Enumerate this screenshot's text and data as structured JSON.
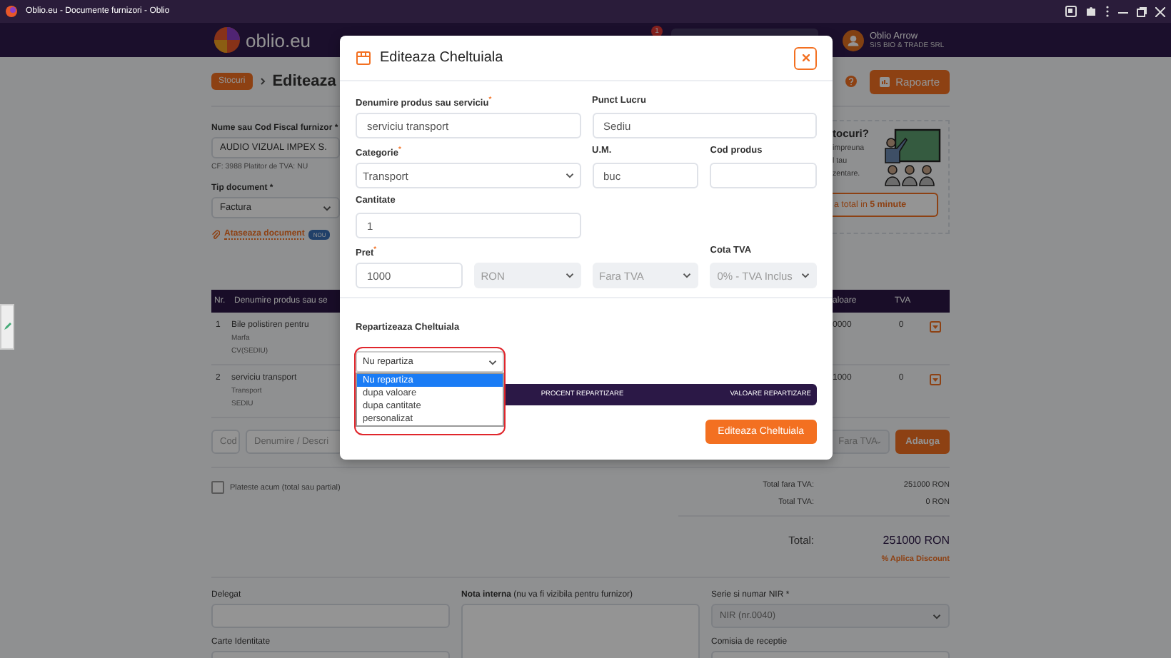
{
  "browser_tab": {
    "title": "Oblio.eu - Documente furnizori - Oblio"
  },
  "header": {
    "logo": "oblio.eu",
    "notification_count": "1",
    "user_name": "Oblio Arrow",
    "company": "SIS BIO & TRADE SRL"
  },
  "breadcrumb": [
    {
      "label": "Stocuri",
      "kind": "badge"
    },
    {
      "label": "Editeaza",
      "kind": "title"
    }
  ],
  "reports_button": "Rapoarte",
  "supplier": {
    "label": "Nume sau Cod Fiscal furnizor *",
    "value": "AUDIO VIZUAL IMPEX S.",
    "info": "CF: 3988   Platitor de TVA: NU"
  },
  "document_type": {
    "label": "Tip document *",
    "value": "Factura"
  },
  "attach": {
    "label": "Ataseaza document",
    "badge": "NOU"
  },
  "promo": {
    "title": "tocuri?",
    "lines": [
      "impreuna",
      "l tau",
      "zentare."
    ],
    "button": "a total in **5 minute**"
  },
  "products_table": {
    "columns": [
      "Nr.",
      "Denumire produs sau se",
      "aloare",
      "TVA"
    ],
    "rows": [
      {
        "nr": "1",
        "name": "Bile polistiren pentru",
        "type": "Marfa",
        "location": "CV(SEDIU)",
        "value": "0000",
        "vat": "0"
      },
      {
        "nr": "2",
        "name": "serviciu transport",
        "type": "Transport",
        "location": "SEDIU",
        "value": "1000",
        "vat": "0"
      }
    ]
  },
  "add_row": {
    "code_placeholder": "Cod",
    "name_placeholder": "Denumire / Descri",
    "vat_select": "Fara TVA",
    "button": "Adauga"
  },
  "pay_now": {
    "label": "Plateste acum (total sau partial)",
    "checked": false
  },
  "totals": [
    {
      "label": "Total fara TVA:",
      "value": "251000 RON",
      "kind": "line"
    },
    {
      "label": "Total TVA:",
      "value": "0 RON",
      "kind": "line"
    },
    {
      "label": "Total:",
      "value": "251000 RON",
      "kind": "grand"
    }
  ],
  "discount_link": "% Aplica Discount",
  "bottom_fields": [
    {
      "label": "Delegat",
      "kind": "input"
    },
    {
      "label": "**Nota interna** (nu va fi vizibila pentru furnizor)",
      "kind": "textarea"
    },
    {
      "label": "Serie si numar NIR *",
      "kind": "select",
      "value": "NIR (nr.0040)"
    },
    {
      "label": "Carte Identitate",
      "kind": "input"
    },
    {
      "label": "Comisia de receptie",
      "kind": "input"
    }
  ],
  "modal": {
    "title": "Editeaza Cheltuiala",
    "fields": [
      {
        "label": "Denumire produs sau serviciu$^{*}$",
        "kind": "input",
        "wide": true,
        "alone": false,
        "value": "serviciu transport",
        "disabled": false
      },
      {
        "label": "Punct Lucru",
        "kind": "input",
        "wide": true,
        "alone": false,
        "value": "Sediu",
        "disabled": false
      },
      {
        "label": "Categorie$^{*}$",
        "kind": "select",
        "wide": true,
        "alone": false,
        "value": "Transport",
        "disabled": false
      },
      {
        "label": "U.M.",
        "kind": "input",
        "wide": false,
        "alone": false,
        "value": "buc",
        "disabled": false
      },
      {
        "label": "Cod produs",
        "kind": "input",
        "wide": false,
        "alone": false,
        "disabled": false
      },
      {
        "label": "Cantitate",
        "kind": "input",
        "wide": true,
        "alone": true,
        "value": "1",
        "disabled": false
      },
      {
        "label": "Pret$^{*}$",
        "kind": "input",
        "wide": false,
        "alone": false,
        "value": "1000",
        "disabled": false
      },
      {
        "kind": "select",
        "wide": false,
        "alone": false,
        "value": "RON",
        "disabled": true
      },
      {
        "kind": "select",
        "wide": false,
        "alone": false,
        "value": "Fara TVA",
        "disabled": true
      },
      {
        "label": "Cota TVA",
        "kind": "select",
        "wide": false,
        "alone": false,
        "value": "0% - TVA Inclus",
        "disabled": true
      }
    ],
    "repartition": {
      "label": "Repartizeaza Cheltuiala",
      "value": "Nu repartiza",
      "options": [
        {
          "label": "Nu repartiza",
          "selected": true
        },
        {
          "label": "dupa valoare",
          "selected": false
        },
        {
          "label": "dupa cantitate",
          "selected": false
        },
        {
          "label": "personalizat",
          "selected": false
        }
      ],
      "columns": [
        "PROCENT REPARTIZARE",
        "VALOARE REPARTIZARE"
      ]
    },
    "submit": "Editeaza Cheltuiala"
  }
}
